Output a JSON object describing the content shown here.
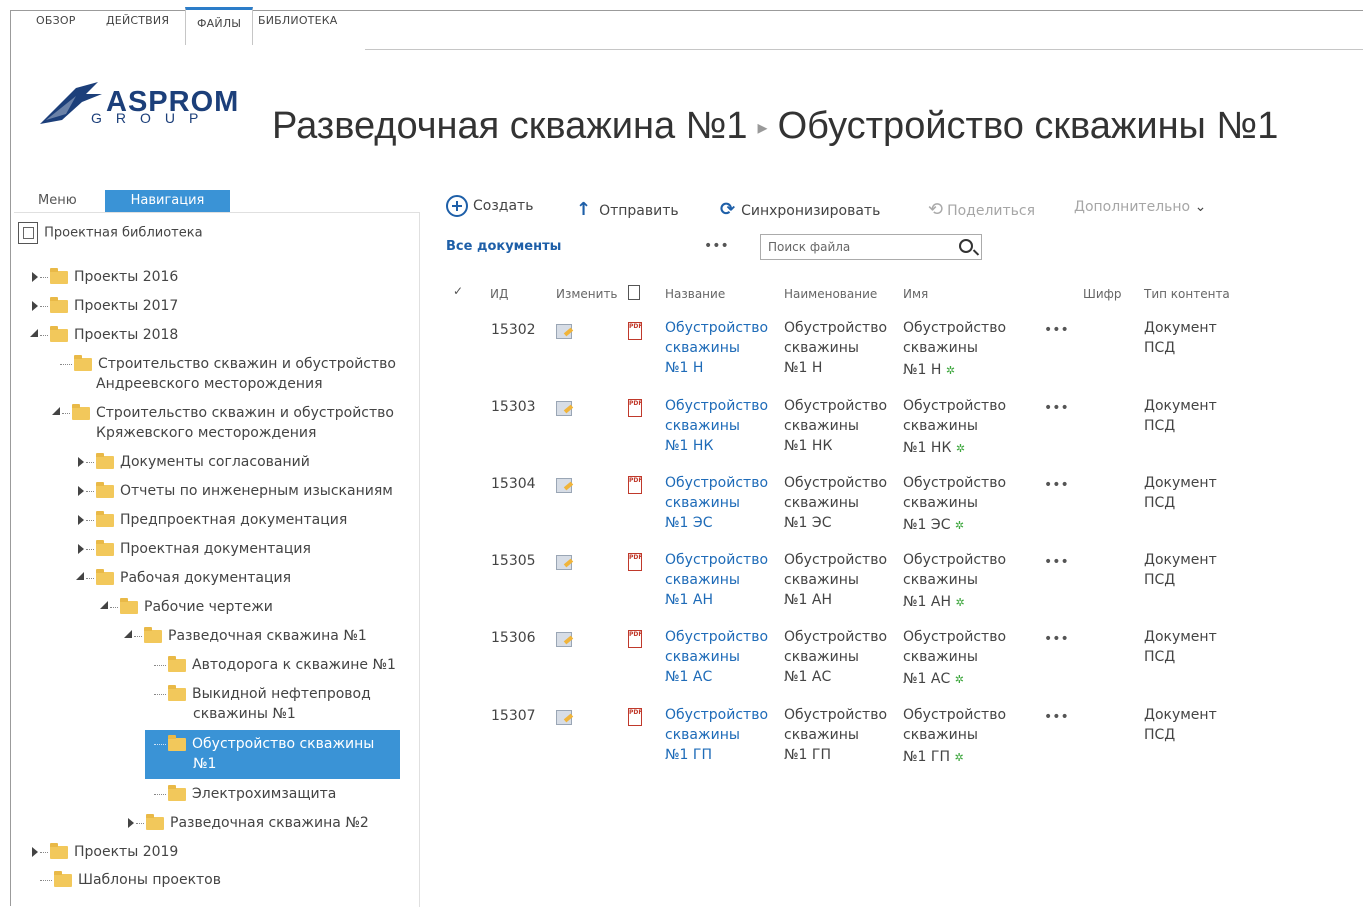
{
  "ribbon": {
    "tabs": [
      {
        "label": "ОБЗОР"
      },
      {
        "label": "ДЕЙСТВИЯ"
      },
      {
        "label": "ФАЙЛЫ"
      },
      {
        "label": "БИБЛИОТЕКА"
      }
    ],
    "active": "ФАЙЛЫ"
  },
  "logo": {
    "main": "ASPROM",
    "sub": "GROUP"
  },
  "breadcrumb": {
    "parent": "Разведочная скважина №1",
    "current": "Обустройство скважины №1"
  },
  "nav": {
    "menu_label": "Меню",
    "nav_label": "Навигация",
    "root": "Проектная библиотека",
    "tree": [
      {
        "label": "Проекты 2016"
      },
      {
        "label": "Проекты 2017"
      },
      {
        "label": "Проекты 2018"
      },
      {
        "label": "Строительство скважин и обустройство",
        "label2": "Андреевского месторождения"
      },
      {
        "label": "Строительство скважин и обустройство",
        "label2": "Кряжевского месторождения"
      },
      {
        "label": "Документы согласований"
      },
      {
        "label": "Отчеты по инженерным изысканиям"
      },
      {
        "label": "Предпроектная документация"
      },
      {
        "label": "Проектная документация"
      },
      {
        "label": "Рабочая документация"
      },
      {
        "label": "Рабочие чертежи"
      },
      {
        "label": "Разведочная скважина №1"
      },
      {
        "label": "Автодорога к скважине №1"
      },
      {
        "label": "Выкидной нефтепровод",
        "label2": "скважины №1"
      },
      {
        "label": "Обустройство скважины",
        "label2": "№1"
      },
      {
        "label": "Электрохимзащита"
      },
      {
        "label": "Разведочная скважина №2"
      },
      {
        "label": "Проекты 2019"
      },
      {
        "label": "Шаблоны проектов"
      }
    ]
  },
  "toolbar": {
    "create": "Создать",
    "send": "Отправить",
    "sync": "Синхронизировать",
    "share": "Поделиться",
    "more": "Дополнительно"
  },
  "views": {
    "all_docs": "Все документы",
    "more": "•••"
  },
  "search": {
    "placeholder": "Поиск файла"
  },
  "table": {
    "headers": {
      "check": "✓",
      "id": "ИД",
      "edit": "Изменить",
      "title": "Название",
      "name": "Наименование",
      "filename": "Имя",
      "cipher": "Шифр",
      "ctype": "Тип контента"
    },
    "rows": [
      {
        "id": "15302",
        "l1": "Обустройство",
        "l2": "скважины",
        "l3": "№1 Н",
        "ct1": "Документ",
        "ct2": "ПСД"
      },
      {
        "id": "15303",
        "l1": "Обустройство",
        "l2": "скважины",
        "l3": "№1 НК",
        "ct1": "Документ",
        "ct2": "ПСД"
      },
      {
        "id": "15304",
        "l1": "Обустройство",
        "l2": "скважины",
        "l3": "№1 ЭС",
        "ct1": "Документ",
        "ct2": "ПСД"
      },
      {
        "id": "15305",
        "l1": "Обустройство",
        "l2": "скважины",
        "l3": "№1 АН",
        "ct1": "Документ",
        "ct2": "ПСД"
      },
      {
        "id": "15306",
        "l1": "Обустройство",
        "l2": "скважины",
        "l3": "№1 АС",
        "ct1": "Документ",
        "ct2": "ПСД"
      },
      {
        "id": "15307",
        "l1": "Обустройство",
        "l2": "скважины",
        "l3": "№1 ГП",
        "ct1": "Документ",
        "ct2": "ПСД"
      }
    ],
    "new_mark": "✲",
    "row_more": "•••"
  }
}
